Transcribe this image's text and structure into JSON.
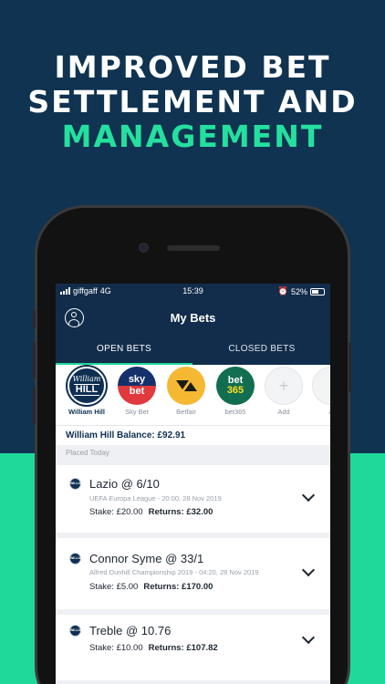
{
  "headline": {
    "line1": "IMPROVED BET",
    "line2": "SETTLEMENT AND",
    "line3": "MANAGEMENT"
  },
  "status_bar": {
    "carrier": "giffgaff",
    "network": "4G",
    "time": "15:39",
    "battery": "52%"
  },
  "app": {
    "title": "My Bets"
  },
  "tabs": [
    {
      "label": "OPEN BETS",
      "active": true
    },
    {
      "label": "CLOSED BETS",
      "active": false
    }
  ],
  "bookmakers": [
    {
      "name": "William Hill",
      "logo_text": "William",
      "logo_text2": "HILL",
      "selected": true
    },
    {
      "name": "Sky Bet",
      "logo_text": "sky",
      "logo_text2": "bet",
      "selected": false
    },
    {
      "name": "Betfair",
      "selected": false
    },
    {
      "name": "bet365",
      "logo_text": "bet",
      "logo_text2": "365",
      "selected": false
    },
    {
      "name": "Add",
      "logo_text": "+",
      "selected": false
    },
    {
      "name": "A",
      "selected": false
    }
  ],
  "balance": {
    "text": "William Hill Balance: £92.91"
  },
  "section_label": "Placed Today",
  "bets": [
    {
      "selection": "Lazio @ 6/10",
      "event": "UEFA Europa League - 20:00, 28 Nov 2019",
      "stake": "Stake: £20.00",
      "returns": "Returns: £32.00",
      "logo": "WILLIAM HILL"
    },
    {
      "selection": "Connor Syme @ 33/1",
      "event": "Alfred Dunhill Championship 2019 - 04:20, 28 Nov 2019",
      "stake": "Stake: £5.00",
      "returns": "Returns: £170.00",
      "logo": "WILLIAM HILL"
    },
    {
      "selection": "Treble @ 10.76",
      "event": "",
      "stake": "Stake: £10.00",
      "returns": "Returns: £107.82",
      "logo": "WILLIAM HILL"
    }
  ],
  "colors": {
    "navy": "#0f3350",
    "mint": "#1fd99a",
    "accent": "#24e09f",
    "app_header": "#122d4b"
  }
}
